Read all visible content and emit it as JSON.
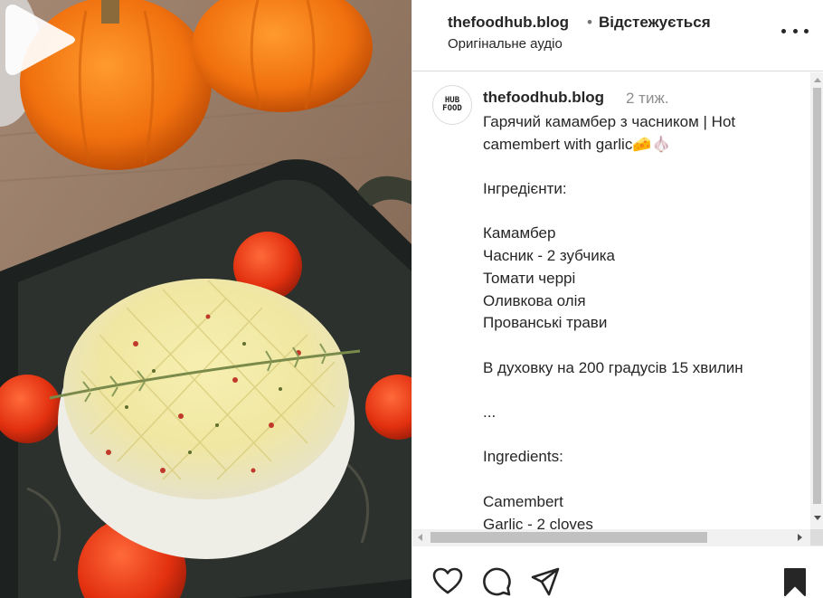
{
  "header": {
    "username": "thefoodhub.blog",
    "separator": "•",
    "follow_status": "Відстежується",
    "audio_label": "Оригінальне аудіо",
    "more_icon": "more-horizontal-icon"
  },
  "caption": {
    "avatar_logo_top": "HUB",
    "avatar_logo_bottom": "FOOD",
    "username": "thefoodhub.blog",
    "time_ago": "2 тиж.",
    "lines": [
      "Гарячий камамбер з часником | Hot",
      "camembert with garlic🧀🧄",
      "",
      "Інгредієнти:",
      "",
      "Камамбер",
      "Часник - 2 зубчика",
      "Томати черрі",
      "Оливкова олія",
      "Прованські трави",
      "",
      "В духовку на 200 градусів 15 хвилин",
      "",
      "...",
      "",
      "Ingredients:",
      "",
      "Camembert",
      "Garlic - 2 cloves"
    ]
  },
  "media": {
    "play_icon": "play-icon"
  },
  "actions": {
    "like_icon": "heart-icon",
    "comment_icon": "comment-icon",
    "share_icon": "share-icon",
    "save_icon": "bookmark-icon"
  },
  "colors": {
    "text": "#262626",
    "muted": "#8e8e8e",
    "border": "#dbdbdb"
  }
}
